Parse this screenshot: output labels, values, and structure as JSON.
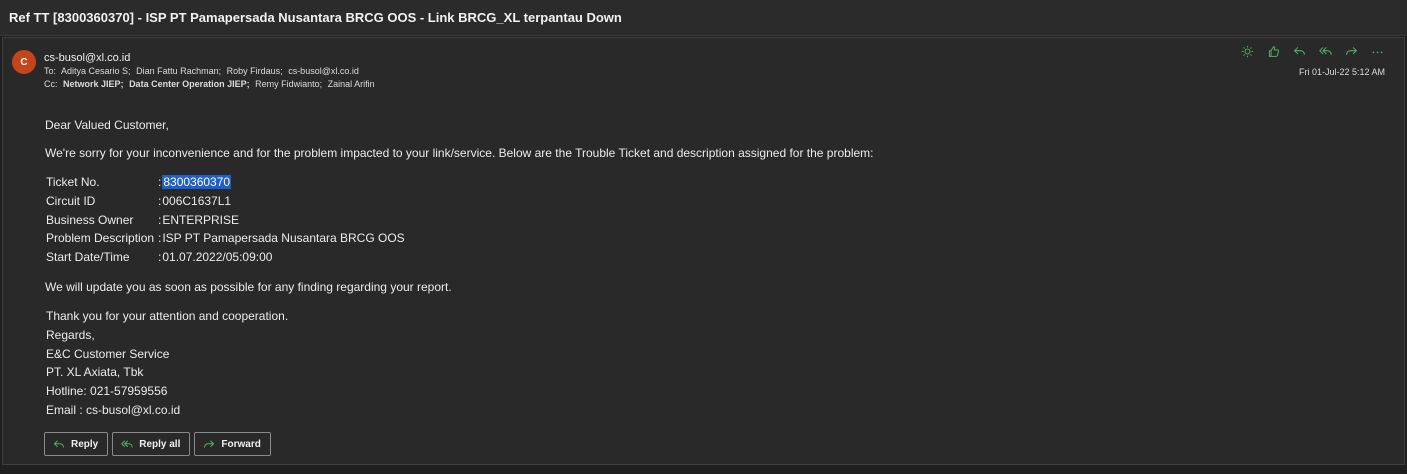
{
  "window": {
    "subject": "Ref TT [8300360370] - ISP PT Pamapersada Nusantara BRCG OOS - Link BRCG_XL terpantau Down"
  },
  "message": {
    "avatar_initial": "C",
    "sender": "cs-busol@xl.co.id",
    "to_label": "To:",
    "to": [
      "Aditya Cesario S;",
      "Dian Fattu Rachman;",
      "Roby Firdaus;",
      "cs-busol@xl.co.id"
    ],
    "cc_label": "Cc:",
    "cc": [
      "Network JIEP;",
      "Data Center Operation JIEP;",
      "Remy Fidwianto;",
      "Zainal Arifin"
    ],
    "timestamp": "Fri 01-Jul-22 5:12 AM",
    "action_icons": [
      "brightness-icon",
      "like-icon",
      "reply-icon",
      "reply-all-icon",
      "forward-icon",
      "more-icon"
    ]
  },
  "body": {
    "greeting": "Dear Valued Customer,",
    "intro": "We're sorry for your inconvenience and for the problem impacted to your link/service. Below are the Trouble Ticket and description assigned for the problem:",
    "ticket": [
      {
        "key": "Ticket No.",
        "value": "8300360370"
      },
      {
        "key": "Circuit ID",
        "value": "006C1637L1"
      },
      {
        "key": "Business Owner",
        "value": "ENTERPRISE"
      },
      {
        "key": "Problem Description",
        "value": "ISP PT Pamapersada Nusantara BRCG OOS"
      },
      {
        "key": "Start Date/Time",
        "value": "01.07.2022/05:09:00"
      }
    ],
    "update": "We will update you as soon as possible for any finding regarding your report.",
    "signature": [
      "Thank you for your attention and cooperation.",
      "Regards,",
      "E&C Customer Service",
      "PT. XL Axiata, Tbk",
      "Hotline: 021-57959556",
      "Email : cs-busol@xl.co.id"
    ]
  },
  "reply_bar": {
    "reply": "Reply",
    "reply_all": "Reply all",
    "forward": "Forward"
  },
  "colors": {
    "background": "#1f1f1f",
    "card": "#292929",
    "avatar": "#c4441b",
    "action_icons": "#4fb06a",
    "selection": "#1f5fc8"
  }
}
